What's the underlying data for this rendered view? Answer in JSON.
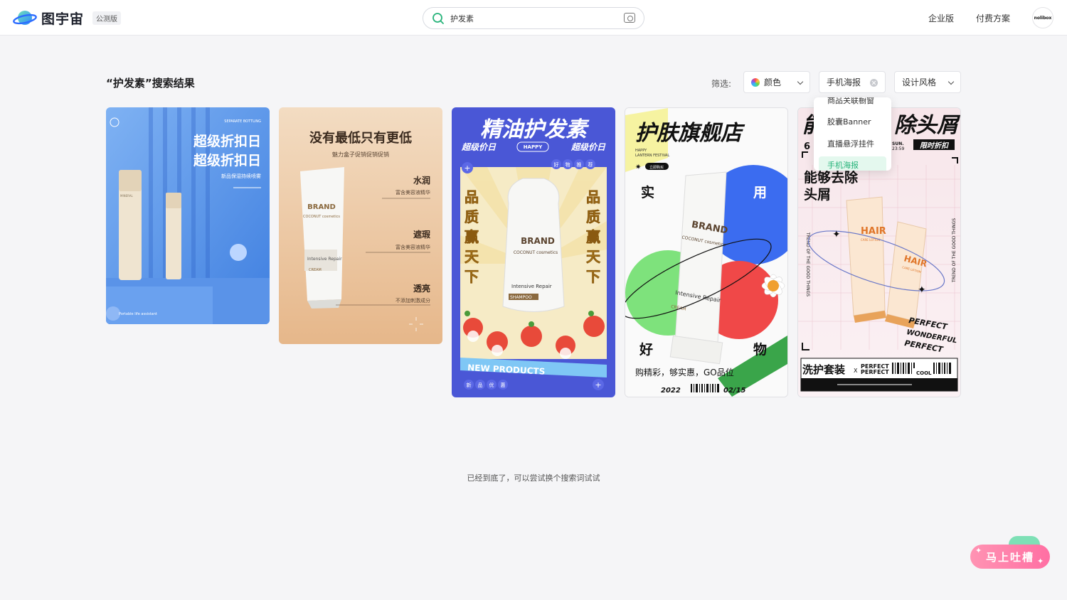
{
  "header": {
    "logo_text": "图宇宙",
    "beta_label": "公测版",
    "search_value": "护发素",
    "enterprise_link": "企业版",
    "pricing_link": "付费方案",
    "avatar_text": "nolibox"
  },
  "results": {
    "title": "“护发素”搜索结果",
    "filter_label": "筛选:",
    "filter_color": "颜色",
    "filter_type": "手机海报",
    "filter_style": "设计风格",
    "end_note": "已经到底了，可以尝试换个搜索词试试"
  },
  "dropdown": {
    "items": [
      "商品关联橱窗",
      "胶囊Banner",
      "直播悬浮挂件",
      "手机海报"
    ],
    "selected": "手机海报"
  },
  "cards": [
    {
      "headline_1": "超级折扣日",
      "headline_2": "超级折扣日",
      "subline": "新品保湿持续喷雾",
      "corner_text": "SEPARATE BOTTLING",
      "footer_text": "Portable life assistant",
      "product_label": "MINERAL"
    },
    {
      "headline": "没有最低只有更低",
      "subline": "魅力盒子促销促销促销",
      "feature_1": "水润",
      "feature_1_desc": "富含美容液精华",
      "feature_2": "遮瑕",
      "feature_2_desc": "富含美容液精华",
      "feature_3": "透亮",
      "feature_3_desc": "不添加刺激成分",
      "brand": "BRAND",
      "brand_sub": "COCONUT cosmetics",
      "product_line": "Intensive Repair",
      "product_tag": "CREAM"
    },
    {
      "headline": "精油护发素",
      "price_left": "超级价日",
      "happy": "HAPPY",
      "price_right": "超级价日",
      "vertical_left": [
        "品",
        "质",
        "赢",
        "天",
        "下"
      ],
      "vertical_right": [
        "品",
        "质",
        "赢",
        "天",
        "下"
      ],
      "brand": "BRAND",
      "brand_sub": "COCONUT cosmetics",
      "product_line": "Intensive Repair",
      "product_tag": "SHAMPOO",
      "banner": "NEW PRODUCTS",
      "badges_top": [
        "好",
        "物",
        "推",
        "荐"
      ],
      "badges_bottom": [
        "新",
        "品",
        "优",
        "惠"
      ]
    },
    {
      "headline": "护肤旗舰店",
      "sub_1": "HAPPY",
      "sub_2": "LANTERN FESTIVAL",
      "tag": "立即购买",
      "char_left_top": "实",
      "char_right_top": "用",
      "char_left_bottom": "好",
      "char_right_bottom": "物",
      "slogan": "购精彩，够实惠，GO品位",
      "date_left": "2022",
      "date_right": "02/15",
      "brand": "BRAND",
      "brand_sub": "COCONUT cosmetics",
      "product_line": "Intensive Repair",
      "product_tag": "CREAM"
    },
    {
      "headline_left": "能",
      "headline_right": "除头屑",
      "number": "6",
      "date_1": "SUN.",
      "date_2": "23:59",
      "deal_tag": "限时折扣",
      "claim_1": "能够去除",
      "claim_2": "头屑",
      "side_text": "TREND OF THE GOOD THINGS",
      "product_1": "HAIR",
      "product_1_sub": "CARE LOTION",
      "product_2": "HAIR",
      "product_2_sub": "CARE LOTION",
      "tag_1": "PERFECT",
      "tag_2": "WONDERFUL",
      "tag_3": "PERFECT",
      "bottom_title": "洗护套装",
      "bottom_x": "X",
      "bottom_p1": "PERFECT",
      "bottom_p2": "PERFECT",
      "bottom_cool": "COOL"
    }
  ],
  "feedback": {
    "label": "马上吐槽"
  },
  "colors": {
    "accent": "#27b37a",
    "feedback": "#ff7aa8"
  }
}
